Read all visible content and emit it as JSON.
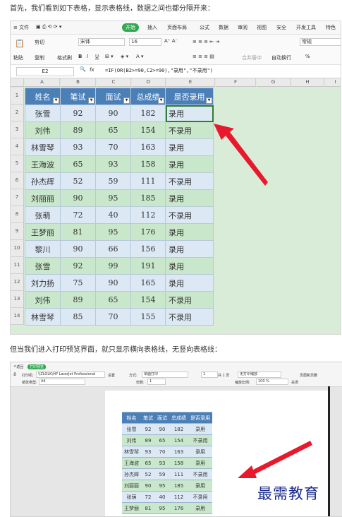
{
  "captions": {
    "intro": "首先，我们看到如下表格，显示表格线，数据之间也都分隔开来：",
    "print": "但当我们进入打印预览界面，就只显示横向表格线，无竖向表格线："
  },
  "spreadsheet": {
    "menu": {
      "file": "≡ 文件",
      "start": "开始",
      "items": [
        "插入",
        "页面布局",
        "公式",
        "数据",
        "审阅",
        "视图",
        "安全",
        "开发工具",
        "特色"
      ]
    },
    "toolbar": {
      "cut": "剪切",
      "copy": "复制",
      "format_painter": "格式刷",
      "paste": "粘贴",
      "font": "宋体",
      "size": "16",
      "merge": "合并居中",
      "wrap": "自动换行",
      "number_format": "常规",
      "percent": "%"
    },
    "namebox": "E2",
    "fx": "fx",
    "formula": "=IF(OR(B2>=90,C2>=90),\"录用\",\"不录用\")",
    "columns": [
      "A",
      "B",
      "C",
      "D",
      "E",
      "F",
      "G",
      "H",
      "I"
    ],
    "rows": [
      "1",
      "2",
      "3",
      "4",
      "5",
      "6",
      "7",
      "8",
      "9",
      "10",
      "11",
      "12",
      "13",
      "14"
    ],
    "headers": [
      "姓名",
      "笔试",
      "面试",
      "总成绩",
      "是否录用"
    ],
    "data": [
      [
        "张雪",
        "92",
        "90",
        "182",
        "录用"
      ],
      [
        "刘伟",
        "89",
        "65",
        "154",
        "不录用"
      ],
      [
        "林雪琴",
        "93",
        "70",
        "163",
        "录用"
      ],
      [
        "王海波",
        "65",
        "93",
        "158",
        "录用"
      ],
      [
        "孙杰辉",
        "52",
        "59",
        "111",
        "不录用"
      ],
      [
        "刘丽丽",
        "90",
        "95",
        "185",
        "录用"
      ],
      [
        "张萌",
        "72",
        "40",
        "112",
        "不录用"
      ],
      [
        "王梦丽",
        "81",
        "95",
        "176",
        "录用"
      ],
      [
        "黎川",
        "90",
        "66",
        "156",
        "录用"
      ],
      [
        "张雪",
        "92",
        "99",
        "191",
        "录用"
      ],
      [
        "刘力扬",
        "75",
        "90",
        "165",
        "录用"
      ],
      [
        "刘伟",
        "89",
        "65",
        "154",
        "不录用"
      ],
      [
        "林雪琴",
        "85",
        "70",
        "155",
        "不录用"
      ]
    ]
  },
  "preview": {
    "back": "返回",
    "badge": "打印预览",
    "printer_label": "打印机:",
    "printer": "\\\\ZLOLK\\HP LaserJet Professional",
    "settings": "设置",
    "direction_label": "方式:",
    "direction": "单面打印",
    "page_current": "1",
    "page_total": "共 1 页",
    "scaling": "无打印缩放",
    "header_footer": "页眉和页脚",
    "paper_label": "纸张类型:",
    "paper": "A4",
    "copies_label": "份数:",
    "copies": "1",
    "scale_label": "缩放比例:",
    "scale": "100 %",
    "close": "关闭",
    "headers": [
      "姓名",
      "笔试",
      "面试",
      "总成绩",
      "是否录用"
    ],
    "data": [
      [
        "张雪",
        "92",
        "90",
        "182",
        "录用"
      ],
      [
        "刘伟",
        "89",
        "65",
        "154",
        "不录用"
      ],
      [
        "林雪琴",
        "93",
        "70",
        "163",
        "录用"
      ],
      [
        "王海波",
        "65",
        "93",
        "158",
        "录用"
      ],
      [
        "孙杰辉",
        "52",
        "59",
        "111",
        "不录用"
      ],
      [
        "刘丽丽",
        "90",
        "95",
        "185",
        "录用"
      ],
      [
        "张萌",
        "72",
        "40",
        "112",
        "不录用"
      ],
      [
        "王梦丽",
        "81",
        "95",
        "176",
        "录用"
      ]
    ]
  },
  "watermark": "最需教育",
  "colors": {
    "header_blue": "#4a7fb8",
    "row_blue": "#dce9f5",
    "row_green": "#c9e7cb",
    "arrow_red": "#e8192c",
    "accent_green": "#2fa84f"
  }
}
